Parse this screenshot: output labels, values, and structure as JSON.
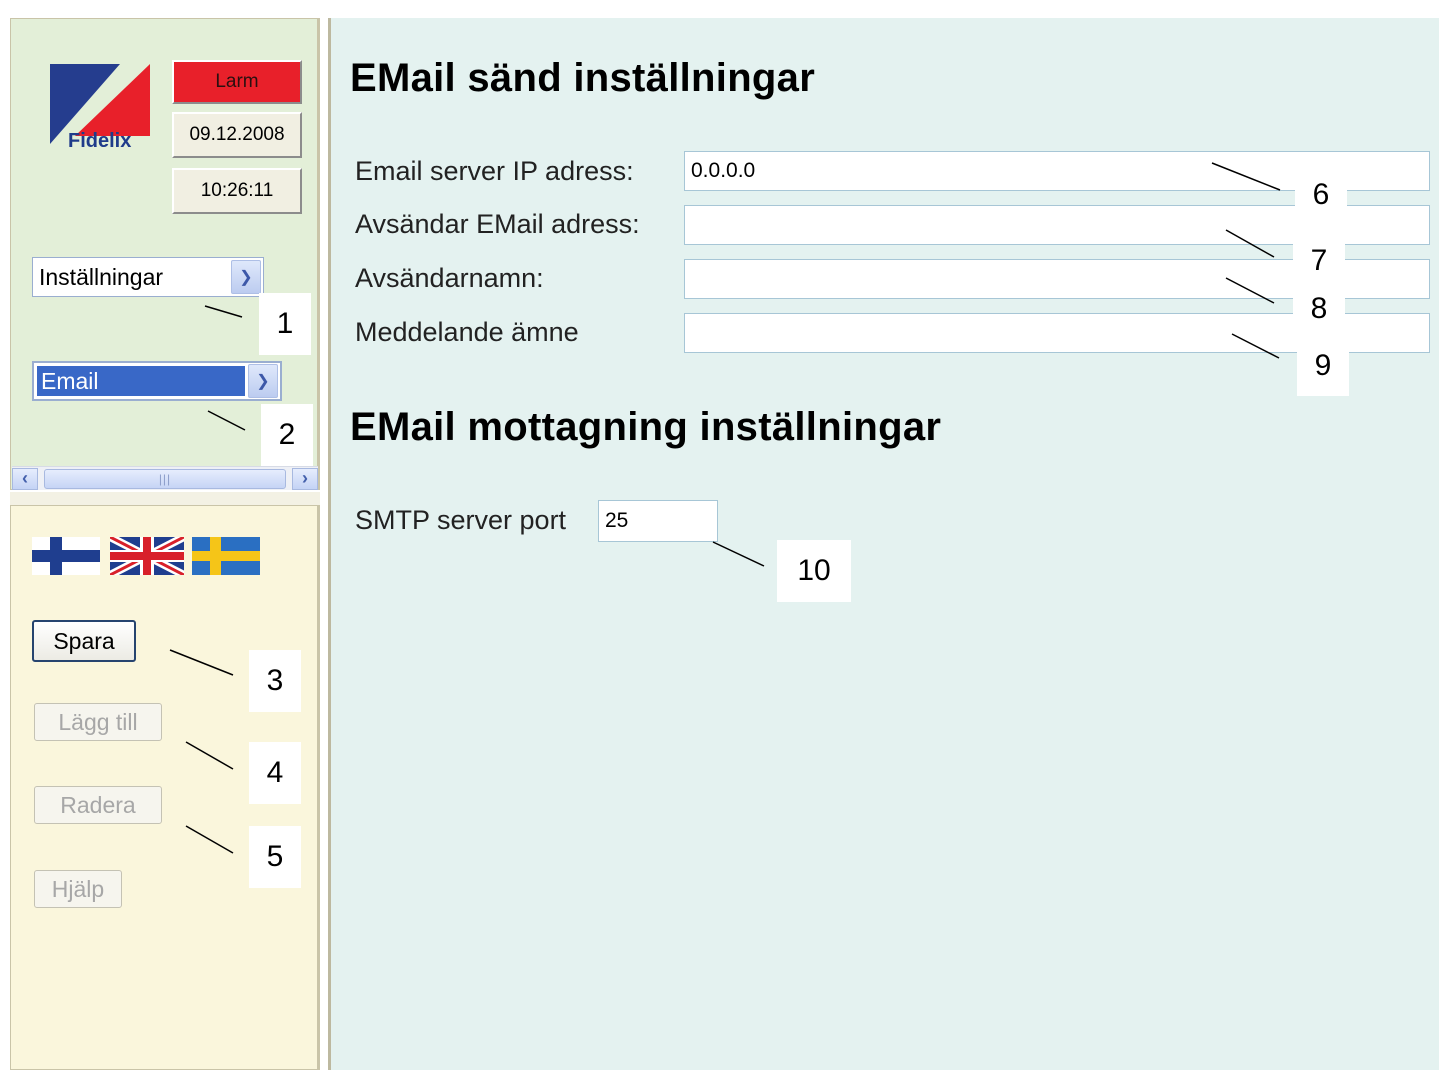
{
  "header": {
    "logo_text": "Fidelix",
    "alarm_label": "Larm",
    "date": "09.12.2008",
    "time": "10:26:11"
  },
  "navigation": {
    "menu_select": "Inställningar",
    "submenu_select": "Email"
  },
  "actions": {
    "save": "Spara",
    "add": "Lägg till",
    "delete": "Radera",
    "help": "Hjälp"
  },
  "main": {
    "send_heading": "EMail sänd inställningar",
    "fields": {
      "server_ip_label": "Email server IP adress:",
      "server_ip_value": "0.0.0.0",
      "sender_address_label": "Avsändar EMail adress:",
      "sender_address_value": "",
      "sender_name_label": "Avsändarnamn:",
      "sender_name_value": "",
      "subject_label": "Meddelande ämne",
      "subject_value": ""
    },
    "receive_heading": "EMail mottagning inställningar",
    "smtp_port_label": "SMTP server port",
    "smtp_port_value": "25"
  },
  "callouts": [
    "1",
    "2",
    "3",
    "4",
    "5",
    "6",
    "7",
    "8",
    "9",
    "10"
  ],
  "colors": {
    "alarm": "#e8202a",
    "top_left_panel": "#e3efd8",
    "bottom_left_panel": "#faf6dc",
    "main_panel": "#e4f2f0",
    "selection": "#3968c7"
  },
  "icons": [
    "flag-finland-icon",
    "flag-uk-icon",
    "flag-sweden-icon",
    "chevron-down-icon",
    "arrow-left-icon",
    "arrow-right-icon"
  ]
}
